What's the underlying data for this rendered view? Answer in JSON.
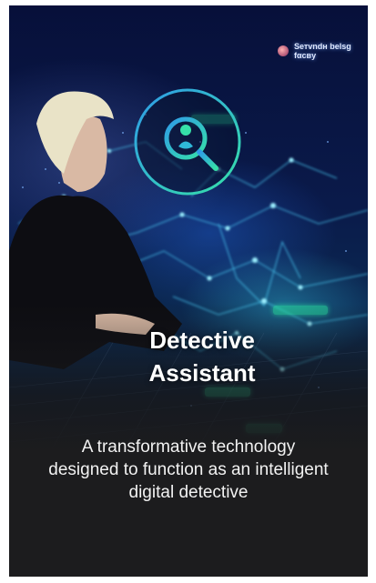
{
  "card": {
    "title_line1": "Detective",
    "title_line2": "Assistant",
    "description": "A transformative technology designed to function as an intelligent digital detective",
    "badge_icon": "person-search-icon"
  },
  "colors": {
    "accent_gradient_start": "#2f9be8",
    "accent_gradient_end": "#36e0a8",
    "panel_bg": "#1c1c1e",
    "text": "#ffffff"
  }
}
